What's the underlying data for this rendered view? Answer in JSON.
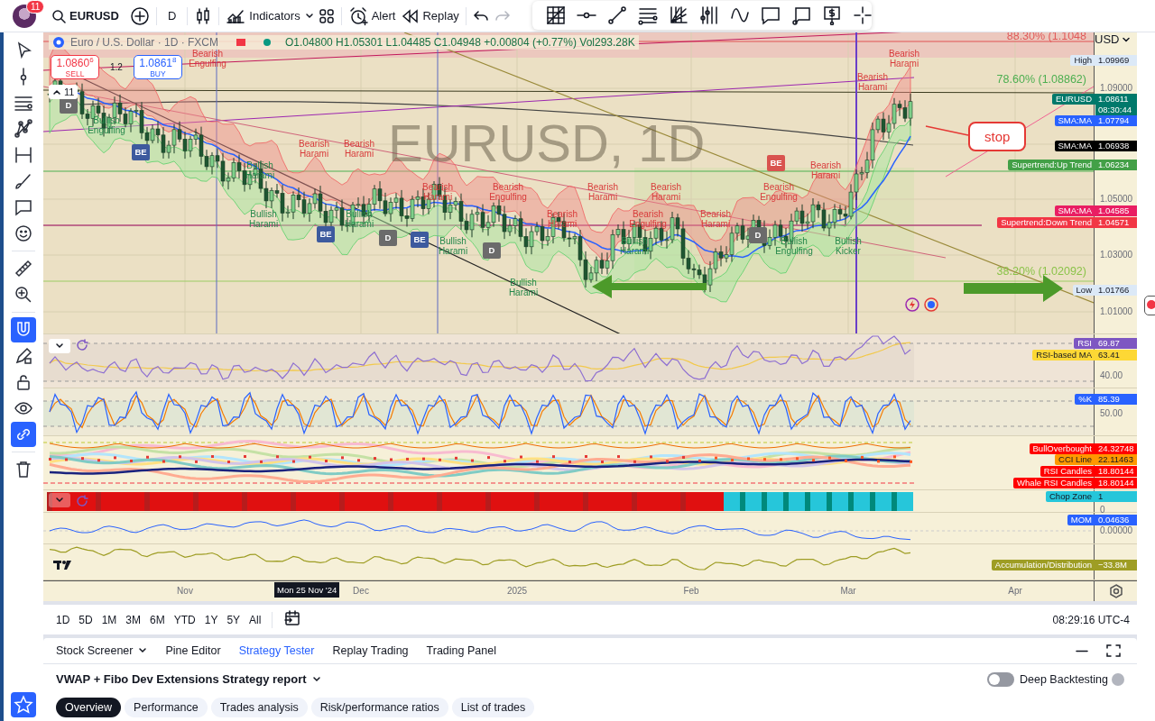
{
  "top_bar": {
    "notifications": "11",
    "symbol": "EURUSD",
    "interval": "D",
    "buttons": [
      {
        "label": "Indicators"
      },
      {
        "label": "Alert"
      },
      {
        "label": "Replay"
      }
    ]
  },
  "left_toolbar": [
    {
      "selected": false
    },
    {
      "selected": false
    },
    {
      "selected": false
    },
    {
      "selected": false
    },
    {
      "selected": false
    },
    {
      "selected": false
    },
    {
      "selected": false
    },
    {
      "selected": false
    },
    {
      "selected": false
    },
    {
      "selected": false
    },
    {
      "selected": true
    },
    {
      "selected": false
    },
    {
      "selected": false
    },
    {
      "selected": false
    },
    {
      "selected": true
    },
    {
      "selected": false
    },
    {
      "selected": true
    }
  ],
  "chart": {
    "legend": {
      "title": "Euro / U.S. Dollar · 1D · FXCM",
      "ohlc": "O1.04800 H1.05301 L1.04485 C1.04948 +0.00804 (+0.77%) Vol293.28K"
    },
    "trade_buttons": [
      {
        "kind": "sell",
        "price": "1.0860$^{6}$",
        "label": "SELL"
      },
      {
        "kind": "buy",
        "price": "1.0861$^{8}$",
        "label": "BUY"
      }
    ],
    "spread": "1.2",
    "indicator_count": "11",
    "watermark": "EURUSD, 1D",
    "currency": "USD",
    "fib_levels": [
      {
        "label": "88.30% (1.1048",
        "color": "#e05a5a"
      },
      {
        "label": "78.60% (1.08862)",
        "color": "#4caf50"
      },
      {
        "label": "38.20% (1.02092)",
        "color": "#8bc34a"
      }
    ],
    "patterns": [
      {
        "text": "Bearish Engulfing",
        "kind": "bearish"
      },
      {
        "text": "Bearish Harami",
        "kind": "bearish"
      },
      {
        "text": "Bearish Harami",
        "kind": "bearish"
      },
      {
        "text": "Bullish Engulfing",
        "kind": "bullish"
      },
      {
        "text": "Bearish Harami",
        "kind": "bearish"
      },
      {
        "text": "Bearish Harami",
        "kind": "bearish"
      },
      {
        "text": "Bullish Harami",
        "kind": "bullish"
      },
      {
        "text": "Bearish Harami",
        "kind": "bearish"
      },
      {
        "text": "Bearish Harami",
        "kind": "bearish"
      },
      {
        "text": "Bearish Engulfing",
        "kind": "bearish"
      },
      {
        "text": "Bearish Harami",
        "kind": "bearish"
      },
      {
        "text": "Bearish Harami",
        "kind": "bearish"
      },
      {
        "text": "Bearish Engulfing",
        "kind": "bearish"
      },
      {
        "text": "Bullish Harami",
        "kind": "bullish"
      },
      {
        "text": "Bullish Harami",
        "kind": "bullish"
      },
      {
        "text": "Bearish Harami",
        "kind": "bearish"
      },
      {
        "text": "Bearish Engulfing",
        "kind": "bearish"
      },
      {
        "text": "Bearish Harami",
        "kind": "bearish"
      },
      {
        "text": "Bullish Harami",
        "kind": "bullish"
      },
      {
        "text": "Bullish Harami",
        "kind": "bullish"
      },
      {
        "text": "Bullish Engulfing",
        "kind": "bullish"
      },
      {
        "text": "Bullish Kicker",
        "kind": "bullish"
      },
      {
        "text": "Bullish Harami",
        "kind": "bullish"
      }
    ],
    "markers": [
      {
        "text": "D",
        "kind": "doji"
      },
      {
        "text": "BE",
        "kind": "bullish"
      },
      {
        "text": "BE",
        "kind": "bullish"
      },
      {
        "text": "D",
        "kind": "doji"
      },
      {
        "text": "BE",
        "kind": "bullish"
      },
      {
        "text": "D",
        "kind": "doji"
      },
      {
        "text": "BE",
        "kind": "bearish"
      },
      {
        "text": "D",
        "kind": "doji"
      }
    ],
    "callout": "stop",
    "price_scale": [
      "1.09000",
      "1.05000",
      "1.03000",
      "1.01000"
    ],
    "price_tags": [
      {
        "name": "High",
        "value": "1.09969",
        "color": "#dce9f7"
      },
      {
        "name": "EURUSD",
        "value": "1.08611",
        "countdown": "08:30:44",
        "color": "#00796b"
      },
      {
        "name": "SMA:MA",
        "value": "1.07794",
        "color": "#2962ff"
      },
      {
        "name": "SMA:MA",
        "value": "1.06938",
        "color": "#000000"
      },
      {
        "name": "Supertrend:Up Trend",
        "value": "1.06234",
        "color": "#43a047"
      },
      {
        "name": "SMA:MA",
        "value": "1.04585",
        "color": "#e91e63"
      },
      {
        "name": "Supertrend:Down Trend",
        "value": "1.04571",
        "color": "#f23645"
      },
      {
        "name": "Low",
        "value": "1.01766",
        "color": "#dce9f7"
      }
    ],
    "panes": [
      {
        "kind": "rsi",
        "ticks": [
          "40.00"
        ],
        "tags": [
          {
            "name": "RSI",
            "value": "69.87",
            "color": "#7e57c2"
          },
          {
            "name": "RSI-based MA",
            "value": "63.41",
            "color": "#fdd835"
          }
        ]
      },
      {
        "kind": "stoch",
        "ticks": [
          "50.00"
        ],
        "tags": [
          {
            "name": "%K",
            "value": "85.39",
            "color": "#2962ff"
          }
        ]
      },
      {
        "kind": "cci",
        "tags": [
          {
            "name": "BullOverbought",
            "value": "24.32748",
            "color": "#ff0000"
          },
          {
            "name": "CCI Line",
            "value": "22.11463",
            "color": "#ff9800"
          },
          {
            "name": "RSI Candles",
            "value": "18.80144",
            "color": "#ff0000"
          },
          {
            "name": "Whale RSI Candles",
            "value": "18.80144",
            "color": "#ff0000"
          }
        ]
      },
      {
        "kind": "chop",
        "ticks": [
          "0"
        ],
        "tags": [
          {
            "name": "Chop Zone",
            "value": "1",
            "color": "#26c6da"
          }
        ]
      },
      {
        "kind": "mom",
        "ticks": [
          "0.00000"
        ],
        "tags": [
          {
            "name": "MOM",
            "value": "0.04636",
            "color": "#2962ff"
          }
        ]
      },
      {
        "kind": "ad",
        "tags": [
          {
            "name": "Accumulation/Distribution",
            "value": "−33.8M",
            "color": "#9e9d24"
          }
        ]
      }
    ],
    "time_axis": [
      "Nov",
      "Dec",
      "2025",
      "Feb",
      "Mar",
      "Apr"
    ],
    "crosshair_date": "Mon 25 Nov '24"
  },
  "range_bar": {
    "ranges": [
      {
        "label": "1D"
      },
      {
        "label": "5D"
      },
      {
        "label": "1M"
      },
      {
        "label": "3M"
      },
      {
        "label": "6M"
      },
      {
        "label": "YTD"
      },
      {
        "label": "1Y"
      },
      {
        "label": "5Y"
      },
      {
        "label": "All"
      }
    ],
    "clock": "08:29:16 UTC-4"
  },
  "bottom_panel": {
    "tabs": [
      {
        "label": "Stock Screener",
        "selected": false,
        "dropdown": true
      },
      {
        "label": "Pine Editor",
        "selected": false,
        "dropdown": false
      },
      {
        "label": "Strategy Tester",
        "selected": true,
        "dropdown": false
      },
      {
        "label": "Replay Trading",
        "selected": false,
        "dropdown": false
      },
      {
        "label": "Trading Panel",
        "selected": false,
        "dropdown": false
      }
    ],
    "report_title": "VWAP + Fibo Dev Extensions Strategy report",
    "deep_backtesting": {
      "label": "Deep Backtesting",
      "on": false
    },
    "report_tabs": [
      {
        "label": "Overview",
        "selected": true
      },
      {
        "label": "Performance",
        "selected": false
      },
      {
        "label": "Trades analysis",
        "selected": false
      },
      {
        "label": "Risk/performance ratios",
        "selected": false
      },
      {
        "label": "List of trades",
        "selected": false
      }
    ]
  }
}
